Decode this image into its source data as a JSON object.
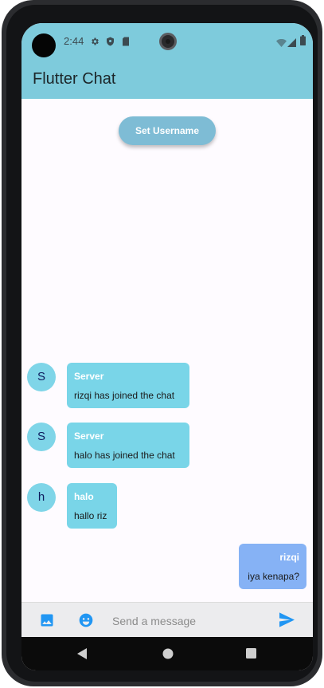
{
  "status_bar": {
    "time": "2:44",
    "left_icons": [
      "gear-icon",
      "shield-icon",
      "sd-card-icon"
    ],
    "right_icons": [
      "wifi-icon",
      "signal-icon",
      "battery-icon"
    ]
  },
  "app_bar": {
    "title": "Flutter Chat",
    "color": "#7ecbdc"
  },
  "actions": {
    "set_username_label": "Set Username"
  },
  "messages": [
    {
      "avatar": "S",
      "sender": "Server",
      "text": "rizqi has joined the chat",
      "outgoing": false
    },
    {
      "avatar": "S",
      "sender": "Server",
      "text": "halo has joined the chat",
      "outgoing": false
    },
    {
      "avatar": "h",
      "sender": "halo",
      "text": "hallo riz",
      "outgoing": false
    },
    {
      "sender": "rizqi",
      "text": "iya kenapa?",
      "outgoing": true
    }
  ],
  "composer": {
    "placeholder": "Send a message",
    "value": "",
    "accent": "#2196f3"
  },
  "colors": {
    "incoming_bubble": "#79d5e8",
    "outgoing_bubble": "#86b2f5",
    "button": "#7ebcd5"
  }
}
